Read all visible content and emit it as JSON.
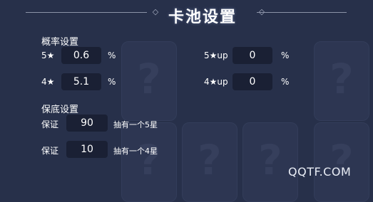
{
  "title": "卡池设置",
  "probability": {
    "heading": "概率设置",
    "rows": [
      {
        "label": "5★",
        "value": "0.6",
        "unit": "%"
      },
      {
        "label": "4★",
        "value": "5.1",
        "unit": "%"
      },
      {
        "label": "5★up",
        "value": "0",
        "unit": "%"
      },
      {
        "label": "4★up",
        "value": "0",
        "unit": "%"
      }
    ]
  },
  "guarantee": {
    "heading": "保底设置",
    "rows": [
      {
        "label": "保证",
        "value": "90",
        "note": "抽有一个5星"
      },
      {
        "label": "保证",
        "value": "10",
        "note": "抽有一个4星"
      }
    ]
  },
  "background_glyph": "?",
  "watermark": "QQTF.COM",
  "colors": {
    "background": "#27304a",
    "input_box": "#1a2034",
    "card_silhouette": "#2d3652"
  }
}
